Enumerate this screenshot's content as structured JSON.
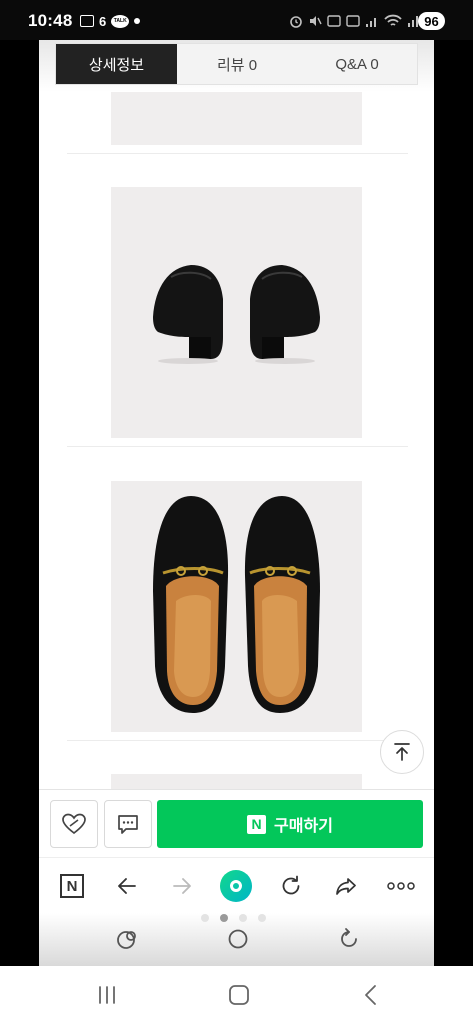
{
  "status_bar": {
    "time": "10:48",
    "notification_count": "6",
    "talk_label": "TALK",
    "battery": "96"
  },
  "tabs": [
    {
      "label": "상세정보",
      "active": true
    },
    {
      "label": "리뷰 0",
      "active": false
    },
    {
      "label": "Q&A 0",
      "active": false
    }
  ],
  "product_photos": [
    {
      "icon": "loafers-back-view"
    },
    {
      "icon": "loafers-top-view"
    }
  ],
  "purchase_bar": {
    "wishlist_icon": "heart-icon",
    "talk_icon": "chat-bubble-icon",
    "buy_logo": "N",
    "buy_label": "구매하기",
    "buy_color": "#03c75a"
  },
  "browser_toolbar": {
    "naver_button": "N"
  },
  "page_indicator": {
    "count": 4,
    "active_index": 1
  }
}
